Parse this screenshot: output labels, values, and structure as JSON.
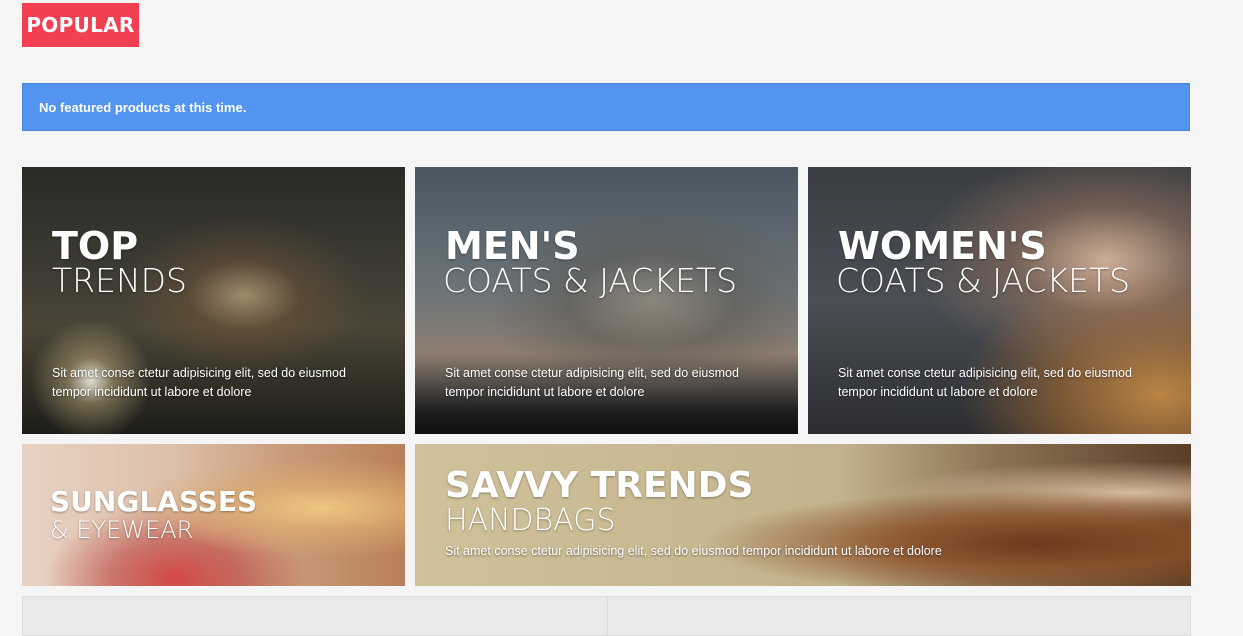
{
  "header": {
    "popular_label": "POPULAR"
  },
  "notice": {
    "text": "No featured products at this time."
  },
  "banners": [
    {
      "title": "TOP",
      "subtitle": "TRENDS",
      "description": "Sit amet conse ctetur adipisicing elit, sed do eiusmod tempor incididunt ut labore et dolore"
    },
    {
      "title": "MEN'S",
      "subtitle": "COATS & JACKETS",
      "description": "Sit amet conse ctetur adipisicing elit, sed do eiusmod tempor incididunt ut labore et dolore"
    },
    {
      "title": "WOMEN'S",
      "subtitle": "COATS & JACKETS",
      "description": "Sit amet conse ctetur adipisicing elit, sed do eiusmod tempor incididunt ut labore et dolore"
    },
    {
      "title": "SUNGLASSES",
      "subtitle": "& EYEWEAR",
      "description": ""
    },
    {
      "title": "SAVVY TRENDS",
      "subtitle": "HANDBAGS",
      "description": "Sit amet conse ctetur adipisicing elit, sed do eiusmod tempor incididunt ut labore et dolore"
    }
  ],
  "colors": {
    "accent_red": "#f23f52",
    "notice_blue": "#5294f0",
    "background": "#f5f5f5"
  }
}
